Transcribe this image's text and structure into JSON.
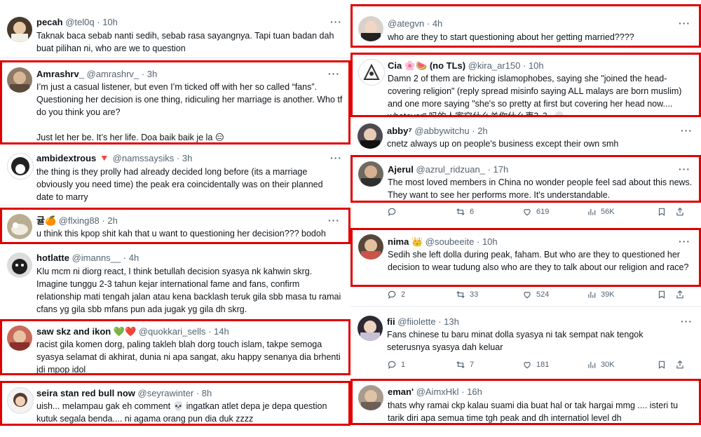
{
  "left": [
    {
      "name": "pecah",
      "handle": "@tel0q",
      "time": "10h",
      "text": "Taknak baca sebab nanti sedih, sebab rasa sayangnya. Tapi tuan badan dah buat pilihan ni, who are we to question"
    },
    {
      "name": "Amrashrv_",
      "handle": "@amrashrv_",
      "time": "3h",
      "text": "I’m just a casual listener, but even I’m ticked off with her so called “fans”. Questioning her decision is one thing, ridiculing her marriage is another. Who tf do you think you are?\n\nJust let her be. It’s her life. Doa baik baik je la 😑"
    },
    {
      "name": "ambidextrous 🔻",
      "handle": "@namssaysiks",
      "time": "3h",
      "text": "the thing is they prolly had already decided long before (its a marriage obviously you need time) the peak era coincidentally was on their planned date to marry"
    },
    {
      "name": "귤🍊",
      "handle": "@flxing88",
      "time": "2h",
      "text": "u think this kpop shit kah that u want to questioning her decision??? bodoh"
    },
    {
      "name": "hotlatte",
      "handle": "@imanns__",
      "time": "4h",
      "text": "Klu mcm ni diorg react, I think betullah decision syasya nk kahwin skrg. Imagine tunggu 2-3 tahun kejar international fame and fans, confirm relationship mati tengah jalan atau kena backlash teruk gila sbb masa tu ramai cfans yg gila sbb mfans pun ada jugak yg gila dh skrg."
    },
    {
      "name": "saw skz and ikon 💚❤️",
      "handle": "@quokkari_sells",
      "time": "14h",
      "text": "racist gila komen dorg, paling takleh blah dorg touch islam, takpe semoga syasya selamat di akhirat, dunia ni apa sangat, aku happy senanya dia brhenti jdi mpop idol"
    },
    {
      "name": "seira stan red bull now",
      "handle": "@seyrawinter",
      "time": "8h",
      "text": "uish... melampau gak eh comment 💀 ingatkan atlet depa je depa question kutuk segala benda.... ni agama orang pun dia duk zzzz"
    }
  ],
  "right": [
    {
      "name": "",
      "handle": "@ategvn",
      "time": "4h",
      "text": "who are they to start questioning about her getting married????"
    },
    {
      "name": "Cia 🌸🍉 (no TLs)",
      "handle": "@kira_ar150",
      "time": "10h",
      "text": "Damn 2 of them are fricking islamophobes, saying she \"joined the head-covering religion\" (reply spread misinfo saying ALL malays are born muslim) and one more saying \"she's so pretty at first but covering her head now.... whatever\" 吗的人家穿什么关你什么事？？ 💀"
    },
    {
      "name": "abby⁷",
      "handle": "@abbywitchu",
      "time": "2h",
      "text": "cnetz always up on people's business except their own smh"
    },
    {
      "name": "Ajerul",
      "handle": "@azrul_ridzuan_",
      "time": "17h",
      "text": "The most loved members in China no wonder people feel sad about this news. They want to see her performs more. It's understandable.",
      "stats": {
        "replies": "",
        "retweets": "6",
        "likes": "619",
        "views": "56K"
      }
    },
    {
      "name": "nima 👑",
      "handle": "@soubeeite",
      "time": "10h",
      "text": "Sedih she left dolla during peak, faham. But who are they to questioned her decision to wear tudung also who are they to talk about our religion and race?",
      "stats": {
        "replies": "2",
        "retweets": "33",
        "likes": "524",
        "views": "39K"
      }
    },
    {
      "name": "fii",
      "handle": "@fiiolette",
      "time": "13h",
      "text": "Fans chinese tu baru minat dolla syasya ni tak sempat nak tengok seterusnya syasya dah keluar",
      "stats": {
        "replies": "1",
        "retweets": "7",
        "likes": "181",
        "views": "30K"
      }
    },
    {
      "name": "eman'",
      "handle": "@AimxHkl",
      "time": "16h",
      "text": "thats why ramai ckp kalau suami dia buat hal or tak hargai mmg .... isteri tu tarik diri apa semua time tgh peak and dh internatiol level dh"
    }
  ],
  "ui": {
    "separator": "·",
    "more": "···"
  },
  "colors": {
    "highlight_border": "#e00000",
    "meta": "#536471"
  }
}
